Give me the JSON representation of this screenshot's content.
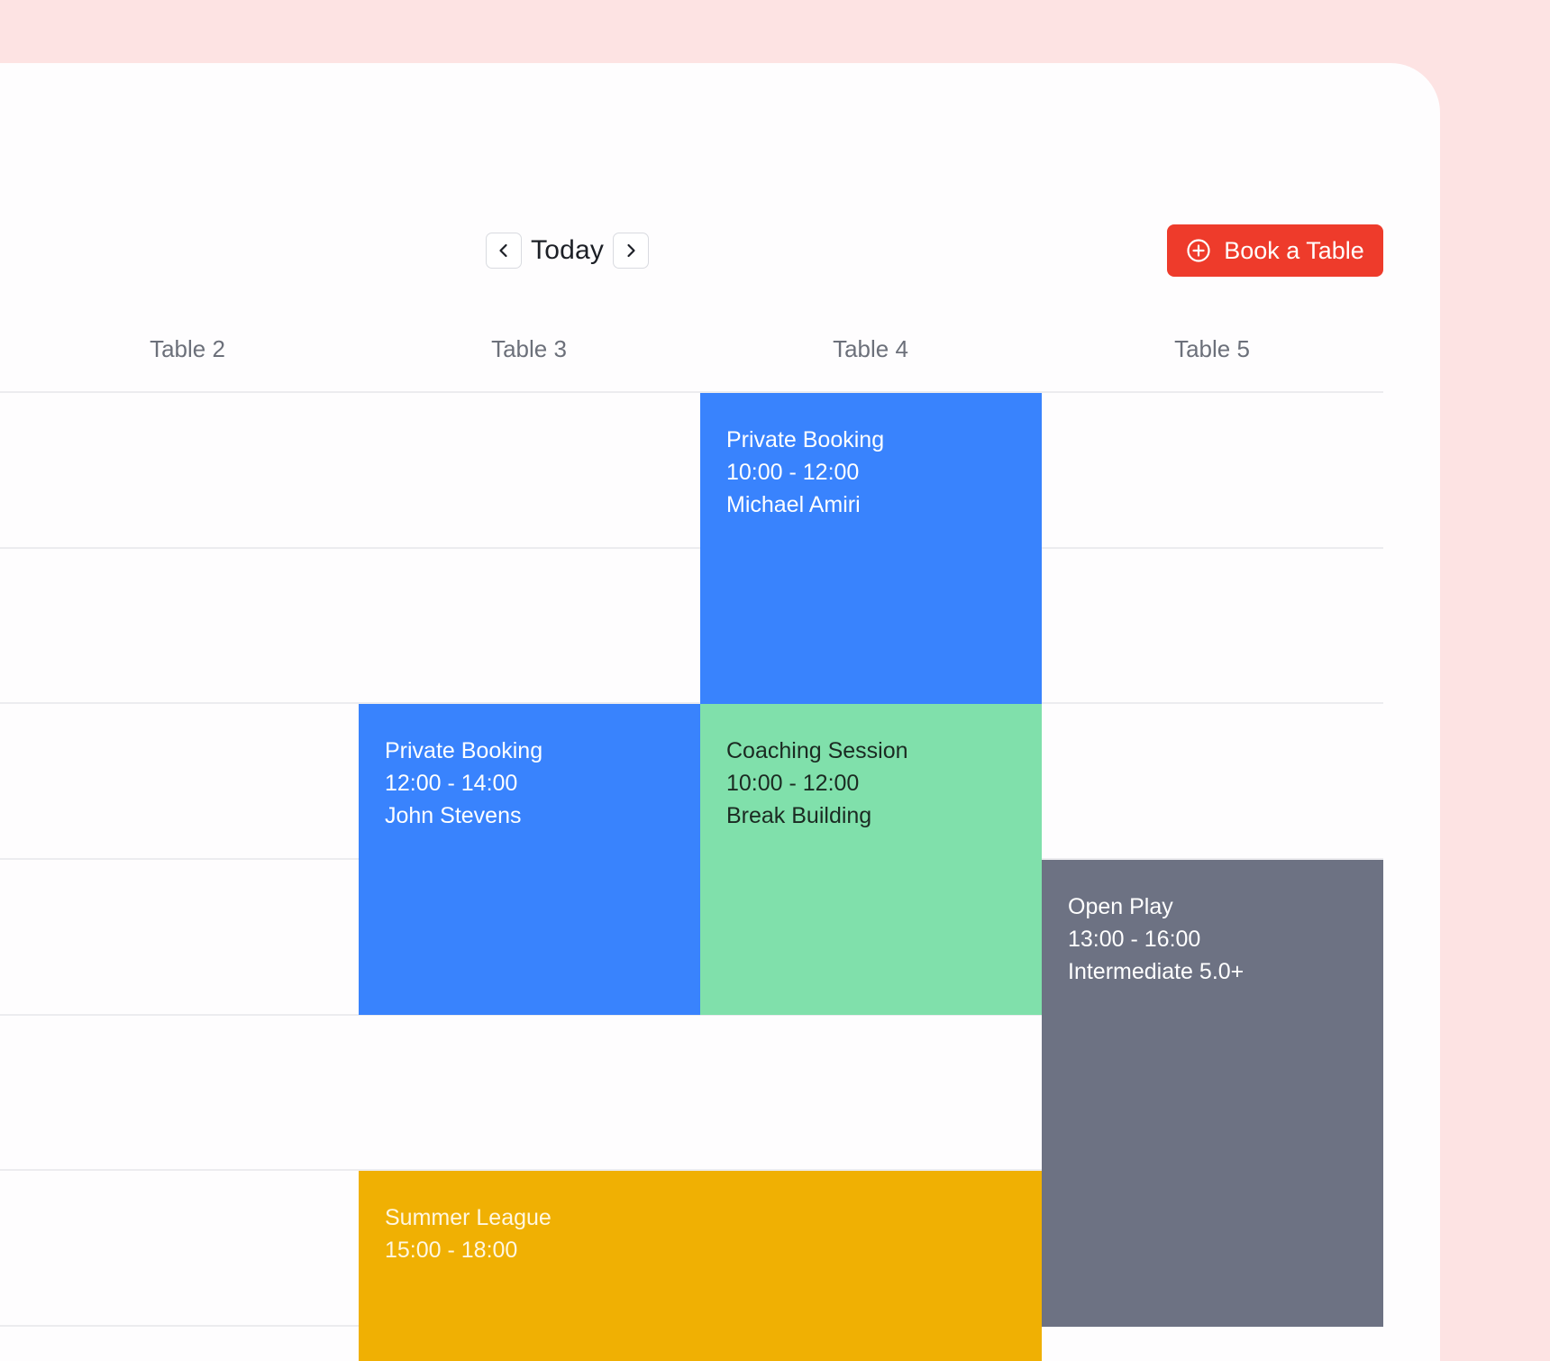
{
  "toolbar": {
    "prev_icon": "chevron-left-icon",
    "today_label": "Today",
    "next_icon": "chevron-right-icon",
    "book_icon": "plus-circle-icon",
    "book_label": "Book a Table",
    "accent_color": "#ee3b2b"
  },
  "columns": [
    "Table 2",
    "Table 3",
    "Table 4",
    "Table 5"
  ],
  "events": [
    {
      "title": "Private Booking",
      "time": "10:00 - 12:00",
      "detail": "Michael Amiri",
      "table": "Table 4",
      "color": "#3983fd"
    },
    {
      "title": "Private Booking",
      "time": "12:00 - 14:00",
      "detail": "John Stevens",
      "table": "Table 3",
      "color": "#3983fd"
    },
    {
      "title": "Coaching Session",
      "time": "10:00 - 12:00",
      "detail": "Break Building",
      "table": "Table 4",
      "color": "#80e0ab"
    },
    {
      "title": "Open Play",
      "time": "13:00 - 16:00",
      "detail": "Intermediate 5.0+",
      "table": "Table 5",
      "color": "#6d7283"
    },
    {
      "title": "Summer League",
      "time": "15:00 - 18:00",
      "table": "Table 3, Table 4",
      "color": "#f0b003"
    }
  ]
}
